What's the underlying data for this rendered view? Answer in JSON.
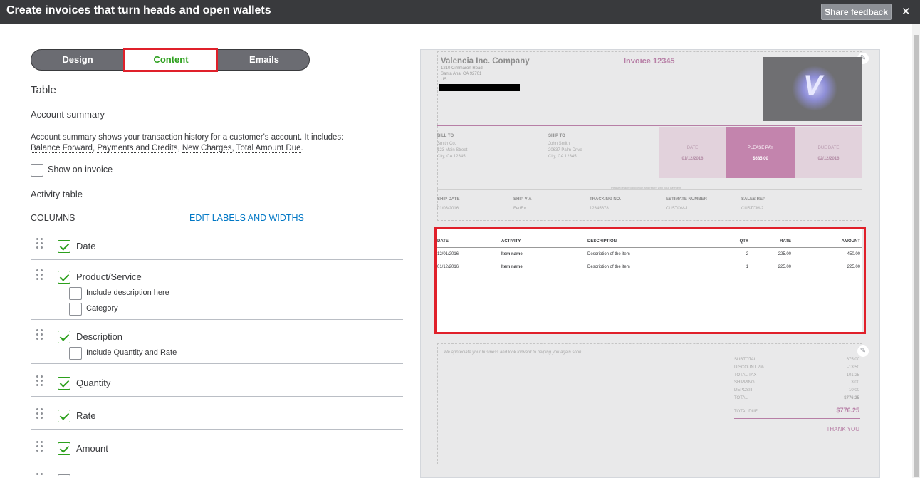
{
  "header": {
    "title": "Create invoices that turn heads and open wallets",
    "feedback_label": "Share feedback",
    "close_glyph": "✕"
  },
  "tabs": [
    {
      "label": "Design"
    },
    {
      "label": "Content",
      "selected": true
    },
    {
      "label": "Emails"
    }
  ],
  "panel": {
    "table_heading": "Table",
    "account_summary_heading": "Account summary",
    "account_summary_text": "Account summary shows your transaction history for a customer's account. It includes:",
    "account_summary_links": [
      "Balance Forward",
      "Payments and Credits",
      "New Charges",
      "Total Amount Due"
    ],
    "show_on_invoice_label": "Show on invoice",
    "show_on_invoice_checked": false,
    "activity_table_heading": "Activity table",
    "columns_heading": "COLUMNS",
    "edit_labels_link": "EDIT LABELS AND WIDTHS",
    "columns": [
      {
        "label": "Date",
        "checked": true
      },
      {
        "label": "Product/Service",
        "checked": true,
        "options": [
          {
            "label": "Include description here",
            "checked": false
          },
          {
            "label": "Category",
            "checked": false
          }
        ]
      },
      {
        "label": "Description",
        "checked": true,
        "options": [
          {
            "label": "Include Quantity and Rate",
            "checked": false
          }
        ]
      },
      {
        "label": "Quantity",
        "checked": true
      },
      {
        "label": "Rate",
        "checked": true
      },
      {
        "label": "Amount",
        "checked": true
      }
    ]
  },
  "invoice": {
    "company": "Valencia Inc. Company",
    "address": [
      "1210 Cimmaron Road",
      "Santa Ana, CA 92701",
      "US"
    ],
    "title": "Invoice 12345",
    "bill_to": {
      "label": "BILL TO",
      "lines": [
        "Smith Co.",
        "123 Main Street",
        "City, CA 12345"
      ]
    },
    "ship_to": {
      "label": "SHIP TO",
      "lines": [
        "John Smith",
        "20637 Palm Drive",
        "City, CA 12345"
      ]
    },
    "date_box": {
      "label": "DATE",
      "value": "01/12/2016"
    },
    "pay_box": {
      "label": "PLEASE PAY",
      "value": "$685.00"
    },
    "due_box": {
      "label": "DUE DATE",
      "value": "02/12/2016"
    },
    "detach_note": "Please detach top portion and return with your payment",
    "shipping": [
      {
        "label": "SHIP DATE",
        "value": "01/03/2016"
      },
      {
        "label": "SHIP VIA",
        "value": "FedEx"
      },
      {
        "label": "TRACKING NO.",
        "value": "12345678"
      },
      {
        "label": "ESTIMATE NUMBER",
        "value": "CUSTOM-1"
      },
      {
        "label": "SALES REP",
        "value": "CUSTOM-2"
      }
    ],
    "table": {
      "headers": [
        "DATE",
        "ACTIVITY",
        "DESCRIPTION",
        "QTY",
        "RATE",
        "AMOUNT"
      ],
      "rows": [
        [
          "12/01/2016",
          "Item name",
          "Description of the item",
          "2",
          "225.00",
          "450.00"
        ],
        [
          "01/12/2016",
          "Item name",
          "Description of the item",
          "1",
          "225.00",
          "225.00"
        ]
      ]
    },
    "footer_message": "We appreciate your business and look forward to helping you again soon.",
    "totals": [
      {
        "label": "SUBTOTAL",
        "value": "675.00"
      },
      {
        "label": "DISCOUNT 2%",
        "value": "-13.50"
      },
      {
        "label": "TOTAL TAX",
        "value": "101.25"
      },
      {
        "label": "SHIPPING",
        "value": "3.00"
      },
      {
        "label": "DEPOSIT",
        "value": "10.00"
      },
      {
        "label": "TOTAL",
        "value": "$776.25"
      }
    ],
    "total_due": {
      "label": "TOTAL DUE",
      "value": "$776.25"
    },
    "thanks": "THANK YOU"
  },
  "colors": {
    "accent": "#2ca01c",
    "link": "#0077c5",
    "brand_pink": "#b77fa6",
    "highlight": "#e0202a"
  }
}
